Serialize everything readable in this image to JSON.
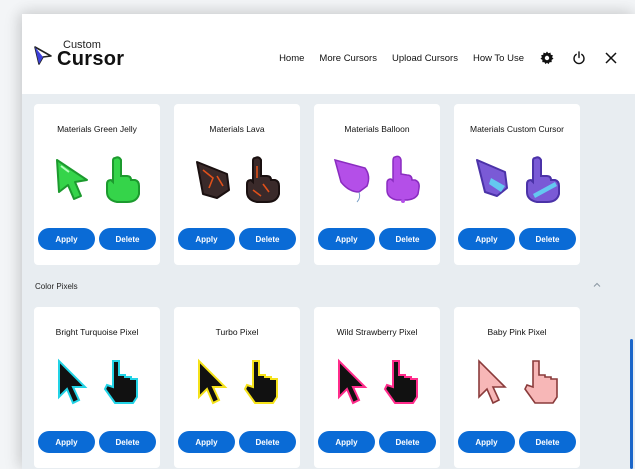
{
  "app": {
    "logo_small": "Custom",
    "logo_big": "Cursor"
  },
  "nav": {
    "home": "Home",
    "more": "More Cursors",
    "upload": "Upload Cursors",
    "howto": "How To Use",
    "icons": [
      "gear-icon",
      "power-icon",
      "close-icon"
    ]
  },
  "section1": {
    "cards": [
      {
        "title": "Materials Green Jelly",
        "apply": "Apply",
        "delete": "Delete"
      },
      {
        "title": "Materials Lava",
        "apply": "Apply",
        "delete": "Delete"
      },
      {
        "title": "Materials Balloon",
        "apply": "Apply",
        "delete": "Delete"
      },
      {
        "title": "Materials Custom Cursor",
        "apply": "Apply",
        "delete": "Delete"
      }
    ]
  },
  "section2": {
    "title": "Color Pixels",
    "cards": [
      {
        "title": "Bright Turquoise Pixel",
        "apply": "Apply",
        "delete": "Delete"
      },
      {
        "title": "Turbo Pixel",
        "apply": "Apply",
        "delete": "Delete"
      },
      {
        "title": "Wild Strawberry Pixel",
        "apply": "Apply",
        "delete": "Delete"
      },
      {
        "title": "Baby Pink Pixel",
        "apply": "Apply",
        "delete": "Delete"
      }
    ]
  },
  "colors": {
    "accent": "#0a6bd6",
    "green": "#35d44a",
    "lava": "#3a2a2a",
    "balloon": "#b44fe8",
    "purple": "#7a5ad6",
    "turquoise": "#22d3e6",
    "turbo": "#f5e21a",
    "strawberry": "#ff2c8b",
    "babypink": "#f7b7b7"
  }
}
